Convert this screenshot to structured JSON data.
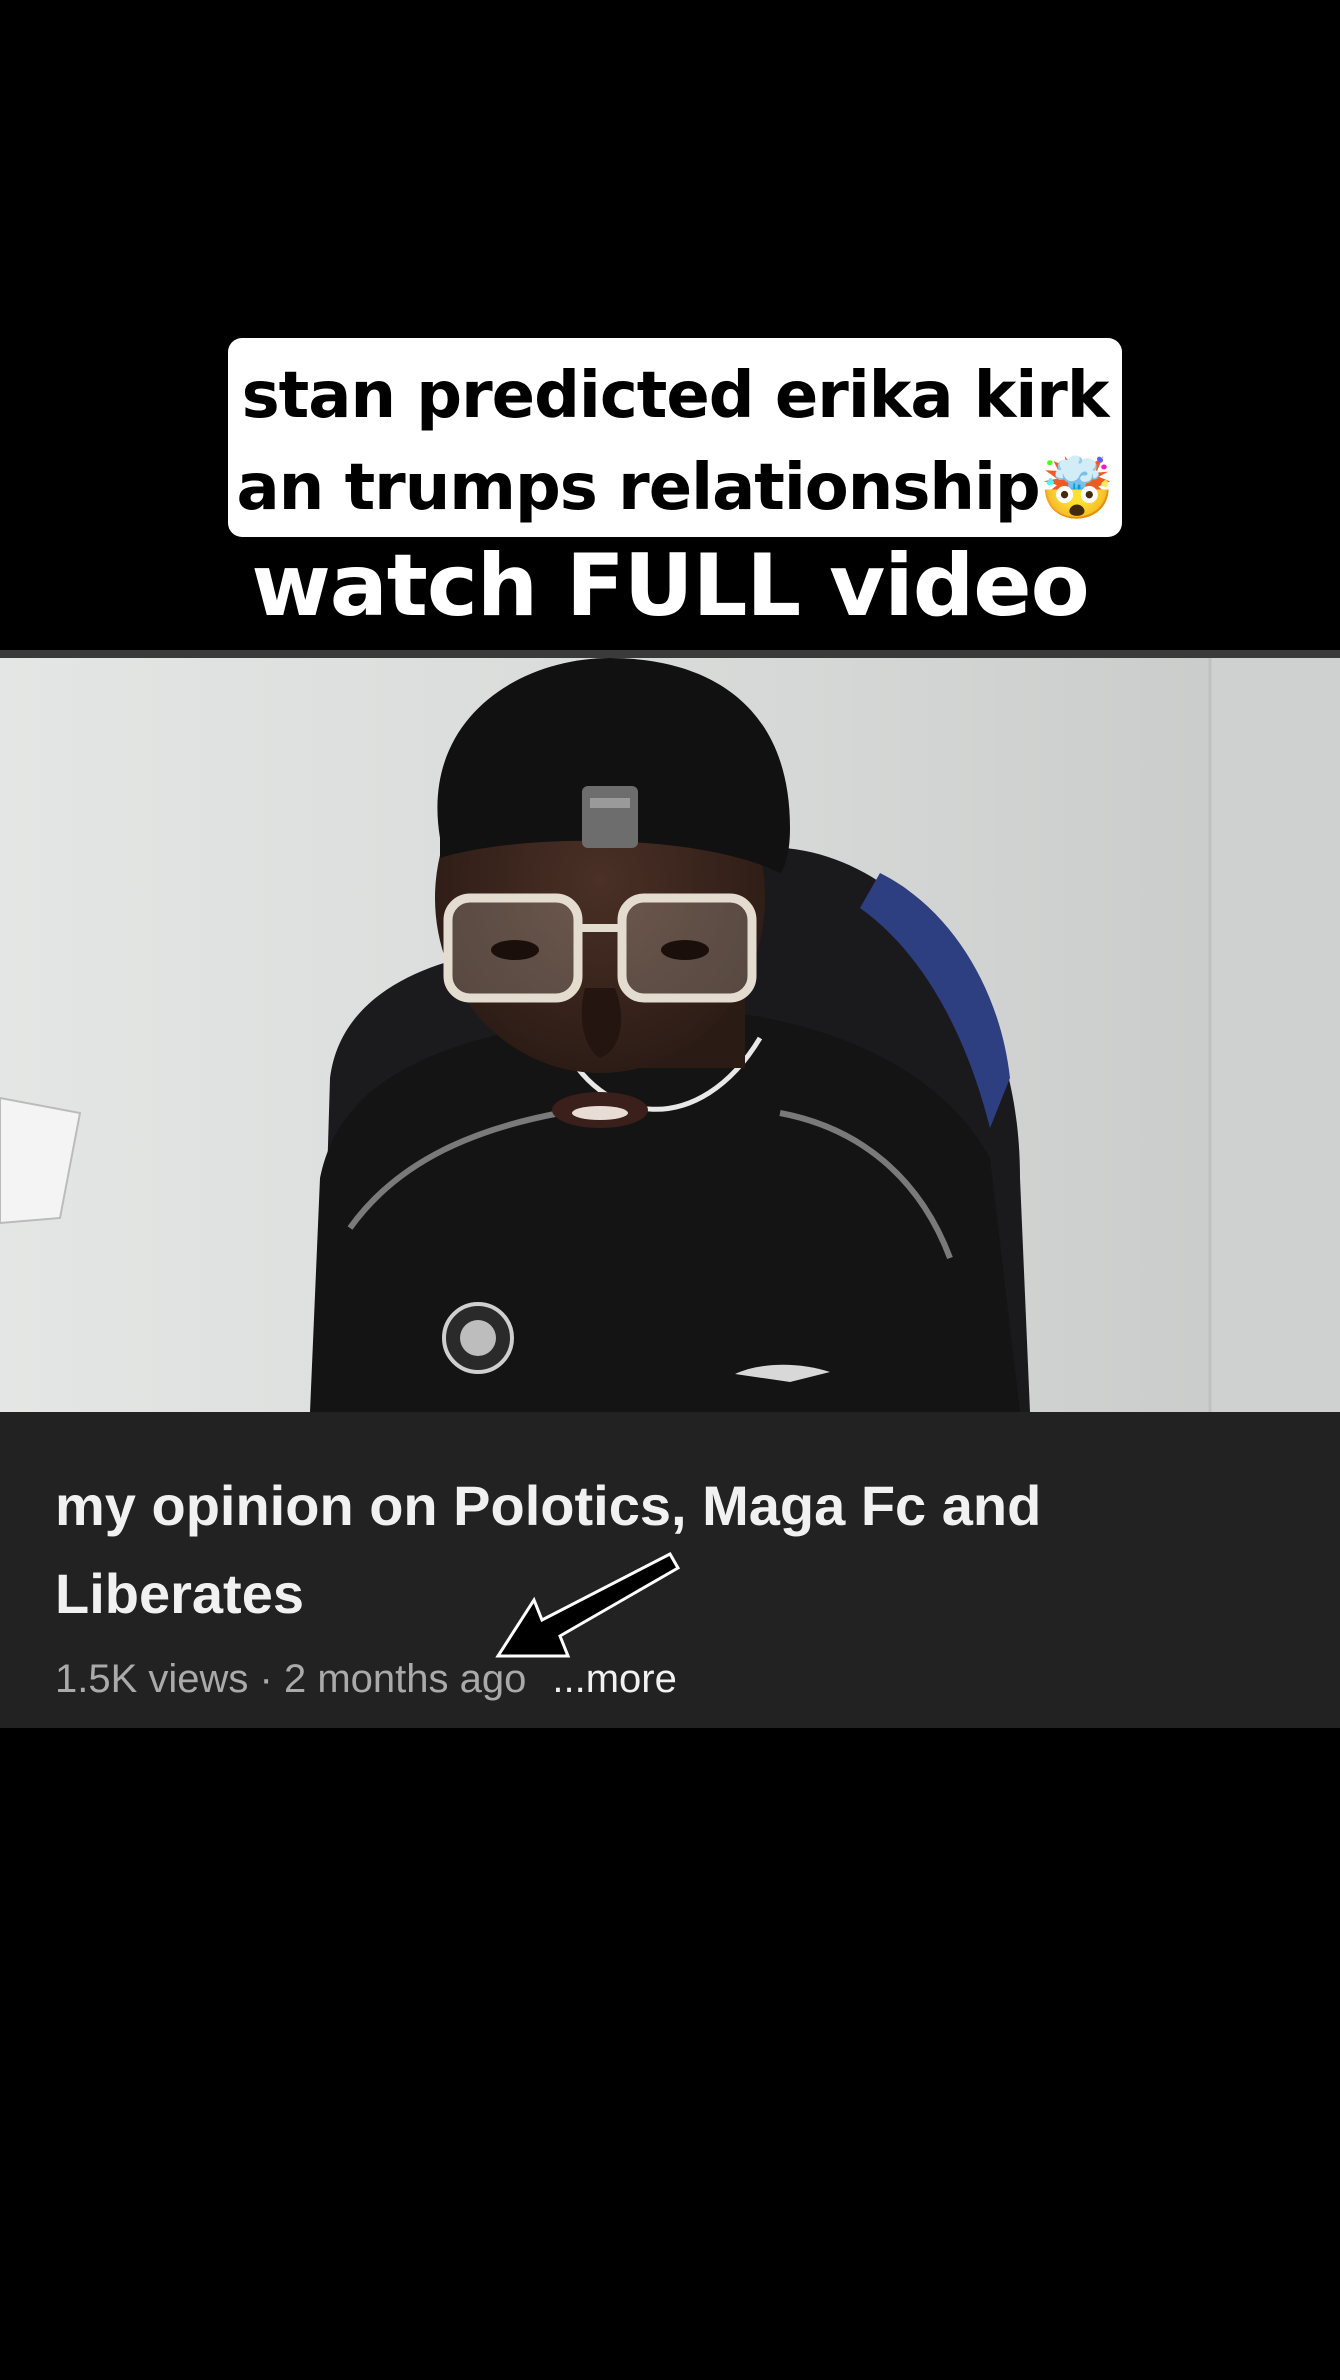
{
  "caption": {
    "line1": "stan predicted erika kirk",
    "line2": "an trumps relationship",
    "emoji": "🤯"
  },
  "subcaption": "watch FULL video",
  "video": {
    "title": "my opinion on Polotics, Maga Fc and Liberates",
    "views": "1.5K views",
    "separator": " · ",
    "age": "2 months ago",
    "more_label": "...more"
  },
  "icons": {
    "arrow": "arrow-pointing-down-left-icon"
  },
  "colors": {
    "background": "#000000",
    "caption_box": "#ffffff",
    "info_panel": "#222222",
    "meta_text": "#aaaaaa"
  }
}
